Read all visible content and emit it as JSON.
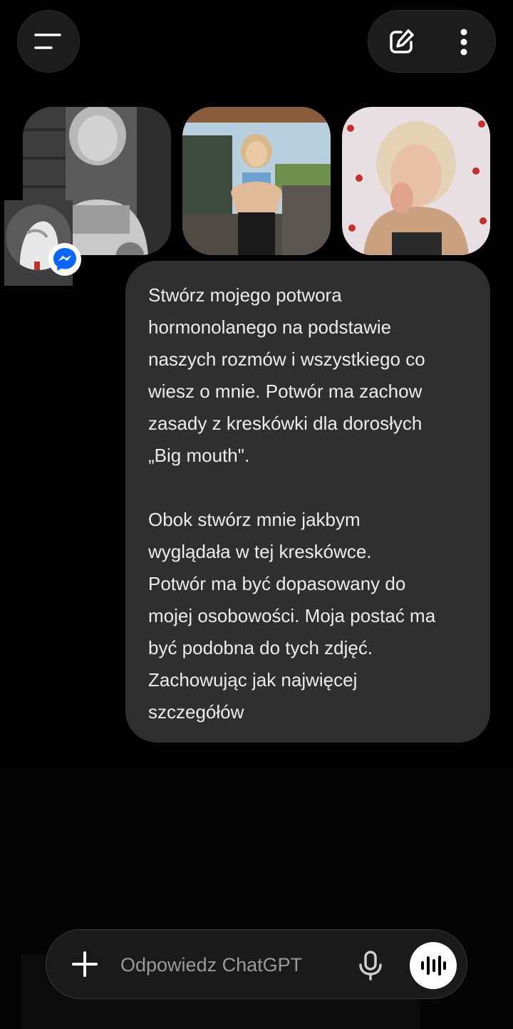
{
  "header": {
    "menu_icon": "menu-icon",
    "new_chat_icon": "edit-icon",
    "more_icon": "more-vertical-icon"
  },
  "attachments": [
    {
      "icon": "photo-thumbnail",
      "tone": "grayscale"
    },
    {
      "icon": "photo-thumbnail",
      "tone": "color"
    },
    {
      "icon": "photo-thumbnail",
      "tone": "color"
    }
  ],
  "chat_head": {
    "icon": "messenger-icon",
    "accent": "#0866ff"
  },
  "message": {
    "paragraph_1": "Stwórz mojego potwora\nhormonolanego na podstawie\nnaszych rozmów i wszystkiego co\nwiesz o mnie. Potwór ma zachow\nzasady z kreskówki dla dorosłych\n„Big mouth\".",
    "paragraph_2": "Obok stwórz mnie jakbym\nwyglądała w tej kreskówce.\nPotwór ma być dopasowany do\nmojej osobowości. Moja postać ma\nbyć podobna do tych zdjęć.\nZachowując jak najwięcej\nszczegółów"
  },
  "composer": {
    "placeholder": "Odpowiedz ChatGPT",
    "value": "",
    "plus_icon": "plus-icon",
    "mic_icon": "microphone-icon",
    "voice_icon": "voice-mode-icon"
  },
  "colors": {
    "background": "#000000",
    "bubble": "#2f2f2f",
    "surface": "#1a1a1a"
  }
}
